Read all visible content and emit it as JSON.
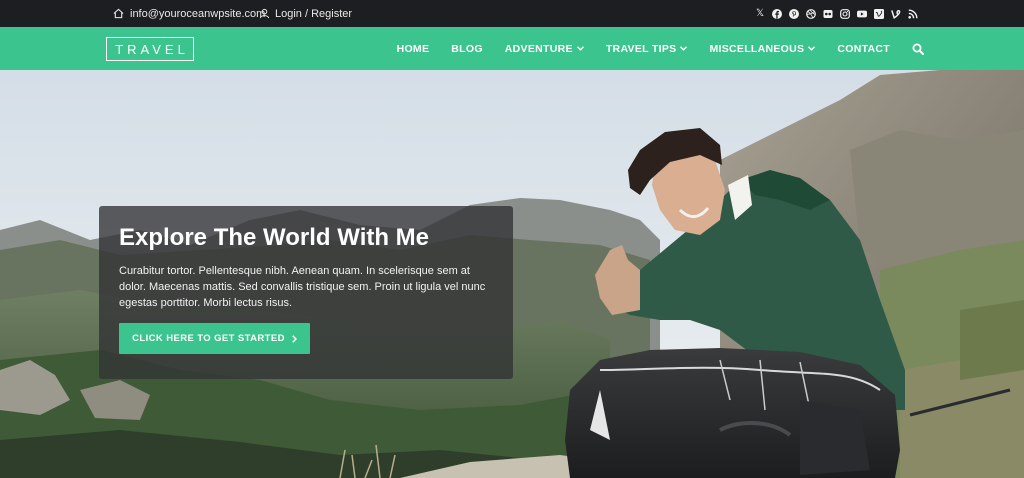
{
  "topbar": {
    "email": "info@youroceanwpsite.com",
    "login": "Login / Register",
    "social_icons": [
      "x-icon",
      "facebook-icon",
      "pinterest-icon",
      "dribbble-icon",
      "flickr-icon",
      "instagram-icon",
      "youtube-icon",
      "vimeo-icon",
      "vine-icon",
      "rss-icon"
    ]
  },
  "logo": {
    "text": "TRAVEL"
  },
  "nav": {
    "home": "HOME",
    "blog": "BLOG",
    "adventure": "ADVENTURE",
    "travel_tips": "TRAVEL TIPS",
    "misc": "MISCELLANEOUS",
    "contact": "CONTACT"
  },
  "hero": {
    "title": "Explore The World With Me",
    "text": "Curabitur tortor. Pellentesque nibh. Aenean quam. In scelerisque sem at dolor. Maecenas mattis. Sed convallis tristique sem. Proin ut ligula vel nunc egestas porttitor. Morbi lectus risus.",
    "cta": "CLICK HERE TO GET STARTED"
  },
  "colors": {
    "accent": "#3cc48f",
    "topbar": "#1d1e21"
  }
}
